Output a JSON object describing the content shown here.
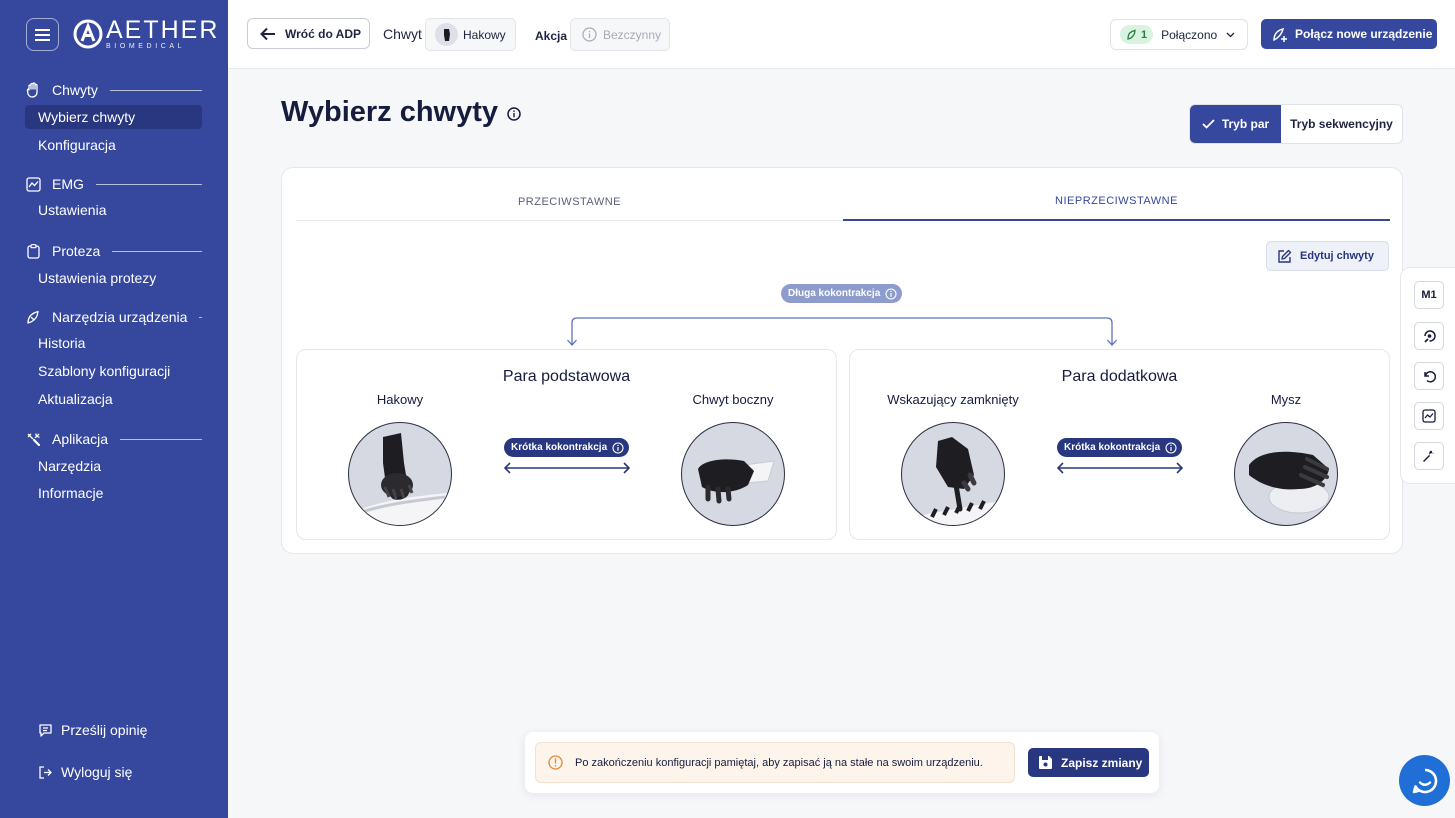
{
  "brand": {
    "name": "AETHER",
    "sub": "BIOMEDICAL"
  },
  "sidebar": {
    "sections": [
      {
        "label": "Chwyty",
        "icon": "hand-icon",
        "items": [
          {
            "label": "Wybierz chwyty",
            "active": true
          },
          {
            "label": "Konfiguracja"
          }
        ]
      },
      {
        "label": "EMG",
        "icon": "chart-icon",
        "items": [
          {
            "label": "Ustawienia"
          }
        ]
      },
      {
        "label": "Proteza",
        "icon": "clipboard-icon",
        "items": [
          {
            "label": "Ustawienia protezy"
          }
        ]
      },
      {
        "label": "Narzędzia urządzenia",
        "icon": "device-tools-icon",
        "items": [
          {
            "label": "Historia"
          },
          {
            "label": "Szablony konfiguracji"
          },
          {
            "label": "Aktualizacja"
          }
        ]
      },
      {
        "label": "Aplikacja",
        "icon": "tools-icon",
        "items": [
          {
            "label": "Narzędzia"
          },
          {
            "label": "Informacje"
          }
        ]
      }
    ],
    "feedback": "Prześlij opinię",
    "logout": "Wyloguj się"
  },
  "topbar": {
    "back": "Wróć do ADP",
    "grip_label": "Chwyt",
    "grip_value": "Hakowy",
    "action_label": "Akcja",
    "action_value": "Bezczynny",
    "conn_count": "1",
    "conn_status": "Połączono",
    "pair_device": "Połącz nowe urządzenie"
  },
  "main": {
    "title": "Wybierz chwyty",
    "mode_pair": "Tryb par",
    "mode_seq": "Tryb sekwencyjny",
    "tabs": [
      {
        "label": "PRZECIWSTAWNE"
      },
      {
        "label": "NIEPRZECIWSTAWNE",
        "active": true
      }
    ],
    "edit": "Edytuj chwyty",
    "long_cocontraction": "Długa kokontrakcja",
    "short_cocontraction": "Krótka kokontrakcja",
    "pairs": [
      {
        "title": "Para podstawowa",
        "left": "Hakowy",
        "right": "Chwyt boczny"
      },
      {
        "title": "Para dodatkowa",
        "left": "Wskazujący zamknięty",
        "right": "Mysz"
      }
    ]
  },
  "tools": {
    "m1": "M1"
  },
  "toast": {
    "message": "Po zakończeniu konfiguracji pamiętaj, aby zapisać ją na stałe na swoim urządzeniu.",
    "save": "Zapisz zmiany"
  },
  "colors": {
    "primary": "#35489e",
    "primary_dark": "#28377f",
    "accent_light": "#8d9ccd",
    "success": "#2d7a45",
    "warning": "#e08a3c"
  }
}
